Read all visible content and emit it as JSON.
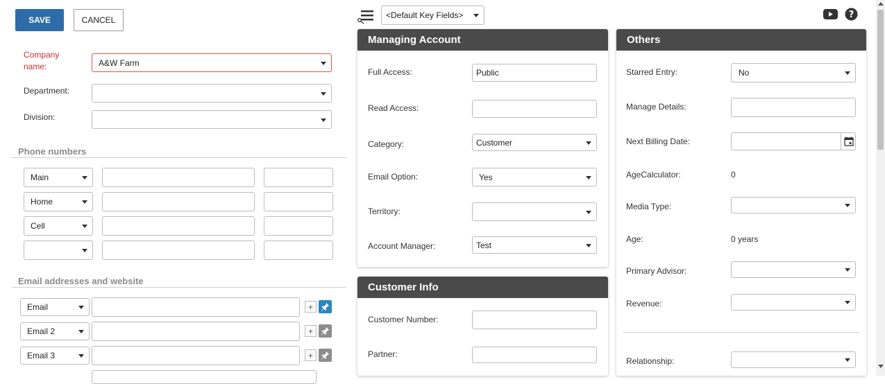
{
  "toolbar": {
    "save_label": "SAVE",
    "cancel_label": "CANCEL",
    "key_fields_value": "<Default Key Fields>"
  },
  "company": {
    "company_label": "Company name:",
    "company_value": "A&W Farm",
    "department_label": "Department:",
    "department_value": "",
    "division_label": "Division:",
    "division_value": ""
  },
  "phones": {
    "title": "Phone numbers",
    "rows": [
      {
        "type": "Main",
        "number": "",
        "ext": ""
      },
      {
        "type": "Home",
        "number": "",
        "ext": ""
      },
      {
        "type": "Cell",
        "number": "",
        "ext": ""
      },
      {
        "type": "",
        "number": "",
        "ext": ""
      }
    ]
  },
  "emails": {
    "title": "Email addresses and website",
    "rows": [
      {
        "type": "Email",
        "value": "",
        "add": "+"
      },
      {
        "type": "Email 2",
        "value": "",
        "add": "+"
      },
      {
        "type": "Email 3",
        "value": "",
        "add": "+"
      }
    ]
  },
  "managing": {
    "title": "Managing Account",
    "full_access_label": "Full Access:",
    "full_access_value": "Public",
    "read_access_label": "Read Access:",
    "read_access_value": "",
    "category_label": "Category:",
    "category_value": "Customer",
    "email_option_label": "Email Option:",
    "email_option_value": "Yes",
    "territory_label": "Territory:",
    "territory_value": "",
    "account_manager_label": "Account Manager:",
    "account_manager_value": "Test"
  },
  "customer": {
    "title": "Customer Info",
    "customer_number_label": "Customer Number:",
    "customer_number_value": "",
    "partner_label": "Partner:",
    "partner_value": ""
  },
  "others": {
    "title": "Others",
    "starred_label": "Starred Entry:",
    "starred_value": "No",
    "manage_details_label": "Manage Details:",
    "manage_details_value": "",
    "next_billing_label": "Next Billing Date:",
    "next_billing_value": "",
    "age_calc_label": "AgeCalculator:",
    "age_calc_value": "0",
    "media_type_label": "Media Type:",
    "media_type_value": "",
    "age_label": "Age:",
    "age_value": "0 years",
    "primary_advisor_label": "Primary Advisor:",
    "primary_advisor_value": "",
    "revenue_label": "Revenue:",
    "revenue_value": "",
    "relationship_label": "Relationship:",
    "relationship_value": ""
  },
  "icons": {
    "menu": "hamburger-scissors-icon",
    "youtube": "youtube-icon",
    "help": "help-icon",
    "calendar": "calendar-icon",
    "pin": "pin-icon"
  },
  "colors": {
    "primary": "#2d6ca8",
    "panel_header": "#4a4a4a",
    "required": "#c9302c",
    "pin_active": "#2d86c0",
    "pin_inactive": "#8d8d8d"
  }
}
